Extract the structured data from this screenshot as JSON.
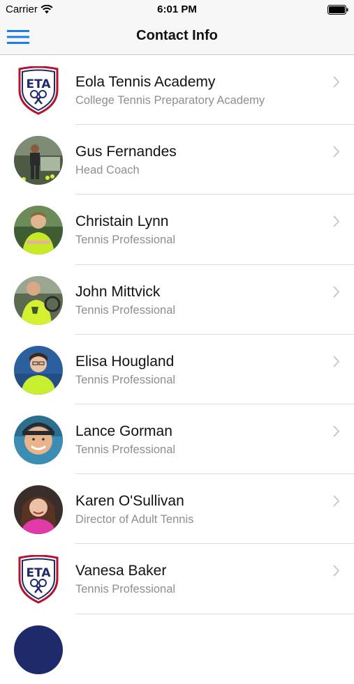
{
  "status_bar": {
    "carrier": "Carrier",
    "time": "6:01 PM"
  },
  "nav": {
    "title": "Contact Info",
    "menu_icon": "hamburger-menu-icon",
    "accent": "#1a7ee6"
  },
  "contacts": [
    {
      "name": "Eola Tennis Academy",
      "role": "College Tennis Preparatory Academy",
      "avatar": "eta-logo",
      "logo_text": "ETA"
    },
    {
      "name": "Gus Fernandes",
      "role": "Head Coach",
      "avatar": "photo"
    },
    {
      "name": "Christain Lynn",
      "role": "Tennis Professional",
      "avatar": "photo"
    },
    {
      "name": "John Mittvick",
      "role": "Tennis Professional",
      "avatar": "photo"
    },
    {
      "name": "Elisa Hougland",
      "role": "Tennis Professional",
      "avatar": "photo"
    },
    {
      "name": "Lance Gorman",
      "role": "Tennis Professional",
      "avatar": "photo"
    },
    {
      "name": "Karen O'Sullivan",
      "role": "Director of Adult Tennis",
      "avatar": "photo"
    },
    {
      "name": "Vanesa Baker",
      "role": "Tennis Professional",
      "avatar": "eta-logo",
      "logo_text": "ETA"
    }
  ],
  "colors": {
    "separator": "#dcdcdf",
    "subtitle": "#8e8e93",
    "chevron": "#c7c7cc",
    "logo_navy": "#1f2a6b",
    "logo_red": "#b3142b"
  }
}
